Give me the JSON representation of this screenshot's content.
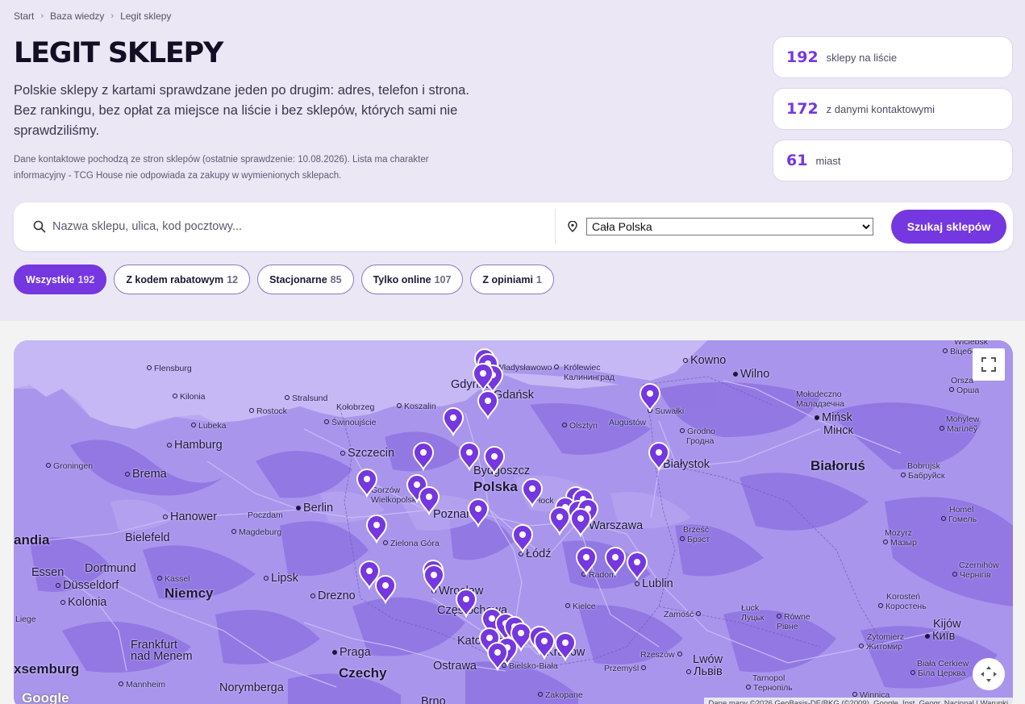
{
  "breadcrumb": {
    "items": [
      "Start",
      "Baza wiedzy",
      "Legit sklepy"
    ],
    "separator": "›"
  },
  "header": {
    "title": "LEGIT SKLEPY",
    "lead": "Polskie sklepy z kartami sprawdzane jeden po drugim: adres, telefon i strona. Bez rankingu, bez opłat za miejsce na liście i bez sklepów, których sami nie sprawdziliśmy.",
    "note": "Dane kontaktowe pochodzą ze stron sklepów (ostatnie sprawdzenie: 10.08.2026). Lista ma charakter informacyjny - TCG House nie odpowiada za zakupy w wymienionych sklepach."
  },
  "stats": [
    {
      "value": "192",
      "label": "sklepy na liście"
    },
    {
      "value": "172",
      "label": "z danymi kontaktowymi"
    },
    {
      "value": "61",
      "label": "miast"
    }
  ],
  "search": {
    "placeholder": "Nazwa sklepu, ulica, kod pocztowy...",
    "value": "",
    "location_selected": "Cała Polska",
    "button_label": "Szukaj sklepów",
    "icons": {
      "search": "search-icon",
      "location": "map-pin-icon"
    }
  },
  "filters": [
    {
      "label": "Wszystkie",
      "count": "192",
      "active": true
    },
    {
      "label": "Z kodem rabatowym",
      "count": "12",
      "active": false
    },
    {
      "label": "Stacjonarne",
      "count": "85",
      "active": false
    },
    {
      "label": "Tylko online",
      "count": "107",
      "active": false
    },
    {
      "label": "Z opiniami",
      "count": "1",
      "active": false
    }
  ],
  "map": {
    "logo": "Google",
    "attribution": "Dane mapy ©2026 GeoBasis-DE/BKG (©2009), Google, Inst. Geogr. Nacional | Warunki",
    "controls": {
      "fullscreen": "fullscreen-icon",
      "camera": "camera-control-icon"
    },
    "labels": [
      "Flensburg",
      "Kilonia",
      "Stralsund",
      "Rostock",
      "Kołobrzeg",
      "Koszalin",
      "Świnoujście",
      "Lubeka",
      "Hamburg",
      "Szczecin",
      "Groningen",
      "Brema",
      "Berlin",
      "Hanower",
      "Poczdam",
      "Magdeburg",
      "Bielefeld",
      "andia",
      "Dortmund",
      "Essen",
      "Düsseldorf",
      "Kassel",
      "Kolonia",
      "Lipsk",
      "Niemcy",
      "Drezno",
      "Liege",
      "Frankfurt",
      "nad Menem",
      "xsemburg",
      "Mannheim",
      "Praga",
      "Czechy",
      "Norymberga",
      "Ostrawa",
      "Brno",
      "Zakopane",
      "Gdynia",
      "Władysławowo",
      "Gdańsk",
      "Królewiec",
      "Калининград",
      "Kowno",
      "Wilno",
      "Olsztyn",
      "Augustów",
      "Suwałki",
      "Grodno",
      "Гродна",
      "Białystok",
      "Bydgoszcz",
      "Polska",
      "Gorzów",
      "Wielkopolski",
      "Poznań",
      "Płock",
      "Warszawa",
      "Łódź",
      "Zielona Góra",
      "Radom",
      "Lublin",
      "Wrocław",
      "Częstochowa",
      "Kielce",
      "Katowice",
      "Kraków",
      "Bielsko-Biała",
      "Rzeszów",
      "Przemyśl",
      "Zamość",
      "Brześć",
      "Брэст",
      "Mińsk",
      "Мінск",
      "Białoruś",
      "Mołodeczno",
      "Маладзечна",
      "Orsza",
      "Орша",
      "Wiciebsk",
      "Віцебск",
      "Mohylew",
      "Магілёў",
      "Bobrujsk",
      "Бабруйск",
      "Homel",
      "Гомель",
      "Mozyrz",
      "Мазыр",
      "Czernihów",
      "Чернігів",
      "Korosteń",
      "Коростень",
      "Łuck",
      "Луцьк",
      "Równe",
      "Рівне",
      "Kijów",
      "Київ",
      "Żytomierz",
      "Житомир",
      "Lwów",
      "Львів",
      "Biała Cerkiew",
      "Біла Церква",
      "Tarnopol",
      "Тернопіль",
      "Winnica"
    ]
  },
  "colors": {
    "accent": "#7437e0",
    "page_bg": "#ebe7f5",
    "map_land": "#a995ec",
    "map_forest": "#8a6fe0",
    "pin": "#7437e0"
  }
}
